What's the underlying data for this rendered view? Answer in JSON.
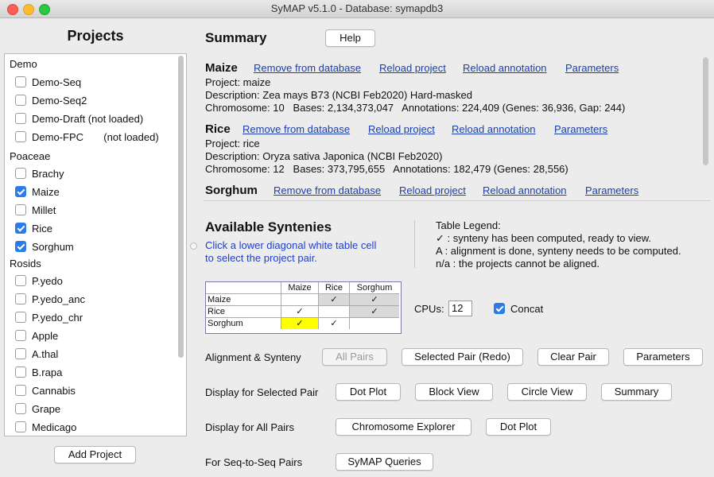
{
  "window": {
    "title": "SyMAP v5.1.0  - Database: symapdb3"
  },
  "projects_panel": {
    "title": "Projects",
    "groups": [
      {
        "label": "Demo",
        "items": [
          {
            "label": "Demo-Seq",
            "checked": false
          },
          {
            "label": "Demo-Seq2",
            "checked": false
          },
          {
            "label": "Demo-Draft (not loaded)",
            "checked": false
          },
          {
            "label": "Demo-FPC       (not loaded)",
            "checked": false
          }
        ]
      },
      {
        "label": "Poaceae",
        "items": [
          {
            "label": "Brachy",
            "checked": false
          },
          {
            "label": "Maize",
            "checked": true
          },
          {
            "label": "Millet",
            "checked": false
          },
          {
            "label": "Rice",
            "checked": true
          },
          {
            "label": "Sorghum",
            "checked": true
          }
        ]
      },
      {
        "label": "Rosids",
        "items": [
          {
            "label": "P.yedo",
            "checked": false
          },
          {
            "label": "P.yedo_anc",
            "checked": false
          },
          {
            "label": "P.yedo_chr",
            "checked": false
          },
          {
            "label": "Apple",
            "checked": false
          },
          {
            "label": "A.thal",
            "checked": false
          },
          {
            "label": "B.rapa",
            "checked": false
          },
          {
            "label": "Cannabis",
            "checked": false
          },
          {
            "label": "Grape",
            "checked": false
          },
          {
            "label": "Medicago",
            "checked": false
          }
        ]
      }
    ],
    "add_button": "Add Project"
  },
  "summary": {
    "title": "Summary",
    "help_button": "Help",
    "projects": [
      {
        "name": "Maize",
        "links": [
          "Remove from database",
          "Reload project",
          "Reload annotation",
          "Parameters"
        ],
        "project_line": "Project: maize",
        "description_line": "Description: Zea mays B73 (NCBI Feb2020) Hard-masked",
        "stats_line": "Chromosome: 10   Bases: 2,134,373,047   Annotations: 224,409 (Genes: 36,936, Gap: 244)"
      },
      {
        "name": "Rice",
        "links": [
          "Remove from database",
          "Reload project",
          "Reload annotation",
          "Parameters"
        ],
        "project_line": "Project: rice",
        "description_line": "Description: Oryza sativa Japonica (NCBI Feb2020)",
        "stats_line": "Chromosome: 12   Bases: 373,795,655   Annotations: 182,479 (Genes: 28,556)"
      },
      {
        "name": "Sorghum",
        "links": [
          "Remove from database",
          "Reload project",
          "Reload annotation",
          "Parameters"
        ]
      }
    ]
  },
  "syntenies": {
    "title": "Available Syntenies",
    "instruction_1": "Click a lower diagonal white table cell",
    "instruction_2": "to select the project pair.",
    "legend_title": "Table Legend:",
    "legend_1": "✓ : synteny has been computed, ready to view.",
    "legend_2": "A : alignment is done, synteny needs to be computed.",
    "legend_3": "n/a : the projects cannot be aligned.",
    "table": {
      "columns": [
        "Maize",
        "Rice",
        "Sorghum"
      ],
      "rows": [
        {
          "name": "Maize",
          "cells": [
            "",
            "✓",
            "✓"
          ]
        },
        {
          "name": "Rice",
          "cells": [
            "✓",
            "",
            "✓"
          ]
        },
        {
          "name": "Sorghum",
          "cells": [
            "✓",
            "✓",
            ""
          ]
        }
      ]
    },
    "cpus_label": "CPUs:",
    "cpus_value": "12",
    "concat_label": "Concat"
  },
  "actions": {
    "alignment_label": "Alignment & Synteny",
    "all_pairs": "All Pairs",
    "selected_pair_redo": "Selected Pair (Redo)",
    "clear_pair": "Clear Pair",
    "parameters": "Parameters",
    "display_selected_label": "Display for Selected Pair",
    "dot_plot": "Dot Plot",
    "block_view": "Block View",
    "circle_view": "Circle View",
    "summary_btn": "Summary",
    "display_all_label": "Display for All Pairs",
    "chromosome_explorer": "Chromosome Explorer",
    "dot_plot_all": "Dot Plot",
    "seq_label": "For Seq-to-Seq Pairs",
    "symap_queries": "SyMAP Queries"
  }
}
